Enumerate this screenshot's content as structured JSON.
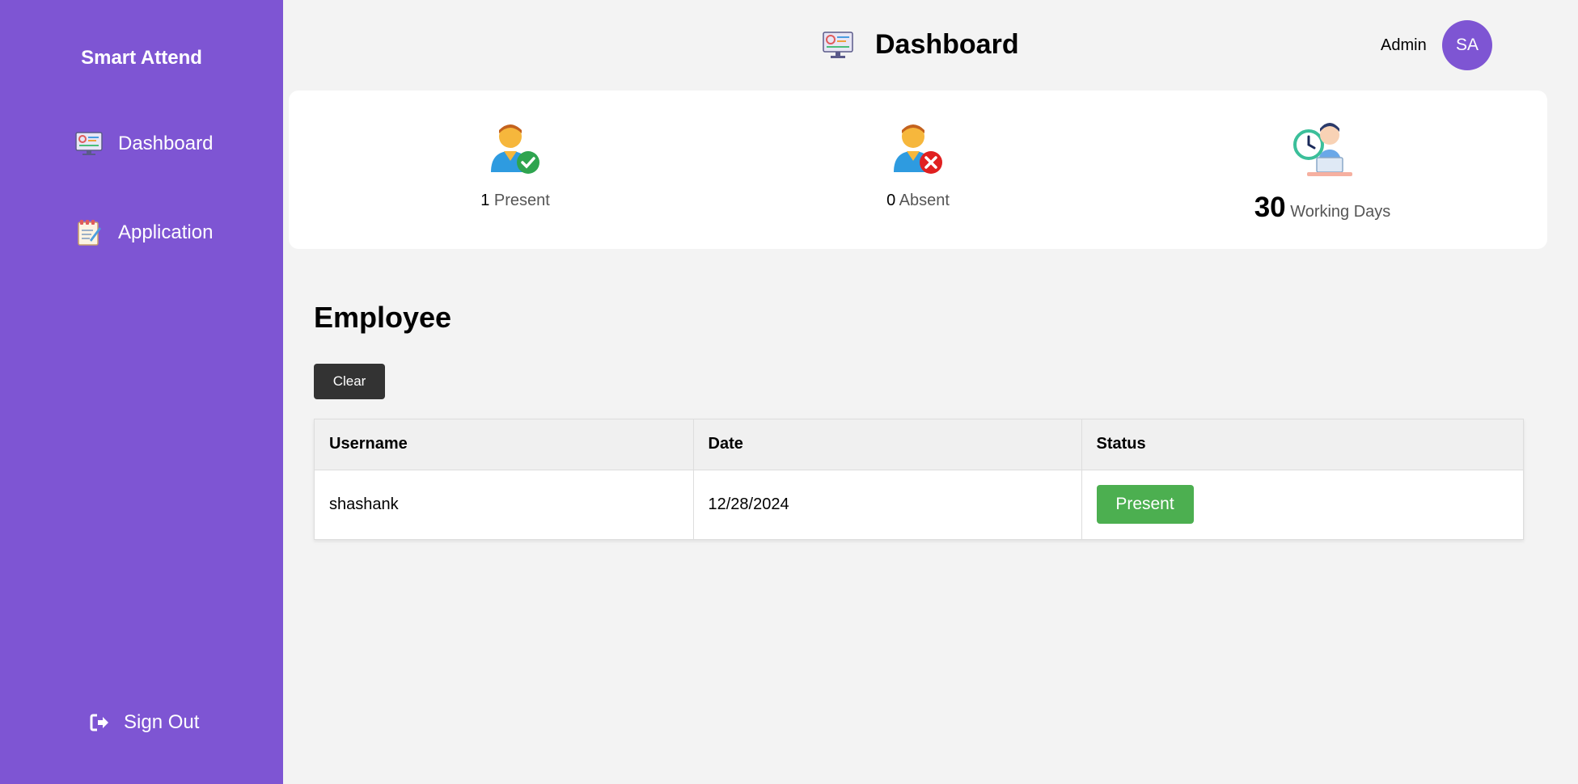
{
  "app": {
    "brand": "Smart Attend"
  },
  "sidebar": {
    "items": [
      {
        "label": "Dashboard",
        "icon": "dashboard-monitor-icon"
      },
      {
        "label": "Application",
        "icon": "application-notepad-icon"
      }
    ],
    "signout": {
      "label": "Sign Out",
      "icon": "sign-out-icon"
    }
  },
  "header": {
    "title": "Dashboard",
    "icon": "dashboard-monitor-icon",
    "user_label": "Admin",
    "avatar_initials": "SA"
  },
  "stats": {
    "present": {
      "value": "1",
      "label": "Present",
      "icon": "user-check-icon"
    },
    "absent": {
      "value": "0",
      "label": "Absent",
      "icon": "user-cross-icon"
    },
    "working_days": {
      "value": "30",
      "label": "Working Days",
      "icon": "working-person-clock-icon"
    }
  },
  "employee": {
    "title": "Employee",
    "clear_label": "Clear",
    "columns": [
      "Username",
      "Date",
      "Status"
    ],
    "rows": [
      {
        "username": "shashank",
        "date": "12/28/2024",
        "status": "Present"
      }
    ]
  },
  "colors": {
    "accent": "#7e55d3",
    "present_green": "#4caf50",
    "button_dark": "#333333"
  }
}
